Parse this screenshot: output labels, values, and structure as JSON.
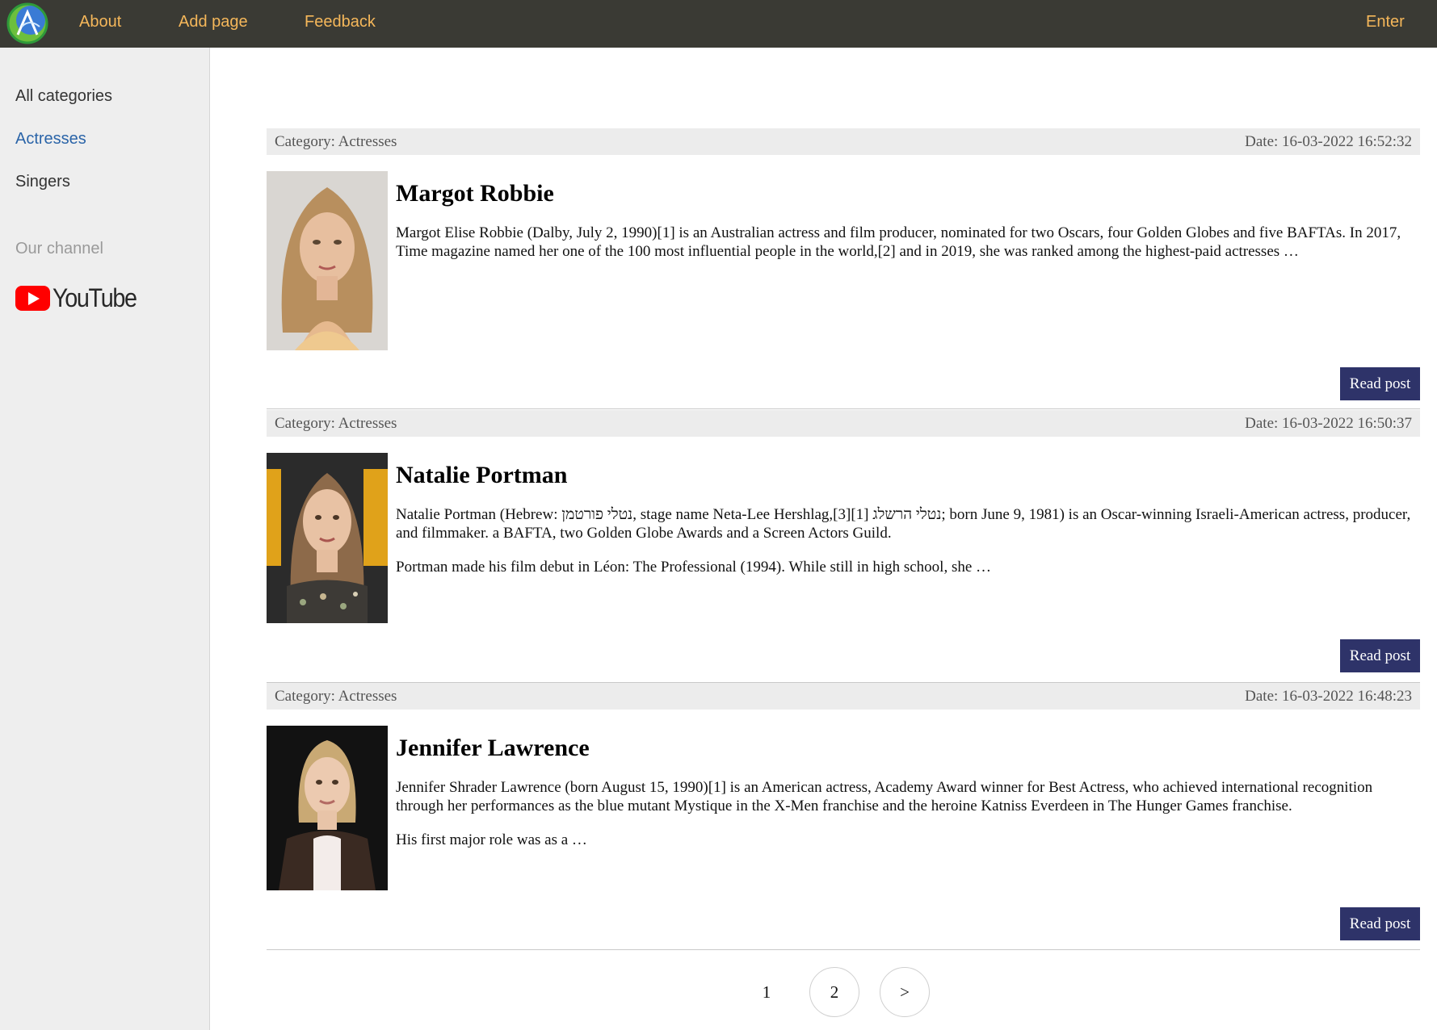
{
  "nav": {
    "about": "About",
    "add_page": "Add page",
    "feedback": "Feedback",
    "enter": "Enter",
    "color": "#f5b75a"
  },
  "sidebar": {
    "all_categories": "All categories",
    "actresses": "Actresses",
    "singers": "Singers",
    "channel_heading": "Our channel",
    "youtube": "YouTube"
  },
  "posts": [
    {
      "category": "Category: Actresses",
      "date": "Date: 16-03-2022 16:52:32",
      "title": "Margot Robbie",
      "text": "Margot Elise Robbie (Dalby, July 2, 1990)[1] is an Australian actress and film producer, nominated for two Oscars, four Golden Globes and five BAFTAs. In 2017, Time magazine named her one of the 100 most influential people in the world,[2] and in 2019, she was ranked among the highest-paid actresses …",
      "text2": "",
      "read": "Read post"
    },
    {
      "category": "Category: Actresses",
      "date": "Date: 16-03-2022 16:50:37",
      "title": "Natalie Portman",
      "text": "Natalie Portman (Hebrew: נטלי פורטמן, stage name Neta-Lee Hershlag,[3][1] נטלי הרשלג; born June 9, 1981) is an Oscar-winning Israeli-American actress, producer, and filmmaker. a BAFTA, two Golden Globe Awards and a Screen Actors Guild.",
      "text2": "Portman made his film debut in Léon: The Professional (1994). While still in high school, she …",
      "read": "Read post"
    },
    {
      "category": "Category: Actresses",
      "date": "Date: 16-03-2022 16:48:23",
      "title": "Jennifer Lawrence",
      "text": "Jennifer Shrader Lawrence (born August 15, 1990)[1] is an American actress, Academy Award winner for Best Actress, who achieved international recognition through her performances as the blue mutant Mystique in the X-Men franchise and the heroine Katniss Everdeen in The Hunger Games franchise.",
      "text2": "His first major role was as a …",
      "read": "Read post"
    }
  ],
  "pagination": {
    "page1": "1",
    "page2": "2",
    "next": ">"
  }
}
